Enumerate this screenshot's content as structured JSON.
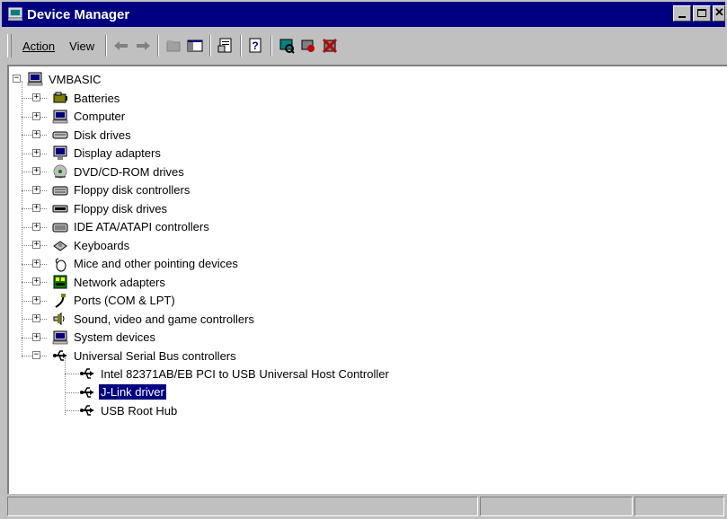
{
  "window": {
    "title": "Device Manager"
  },
  "menu": {
    "action": "Action",
    "view": "View"
  },
  "toolbar_icons": [
    "back-arrow-icon",
    "forward-arrow-icon",
    "up-folder-icon",
    "show-hide-tree-icon",
    "properties-icon",
    "help-icon",
    "scan-hardware-icon",
    "update-driver-icon",
    "uninstall-icon"
  ],
  "tree": {
    "root": "VMBASIC",
    "categories": [
      "Batteries",
      "Computer",
      "Disk drives",
      "Display adapters",
      "DVD/CD-ROM drives",
      "Floppy disk controllers",
      "Floppy disk drives",
      "IDE ATA/ATAPI controllers",
      "Keyboards",
      "Mice and other pointing devices",
      "Network adapters",
      "Ports (COM & LPT)",
      "Sound, video and game controllers",
      "System devices",
      "Universal Serial Bus controllers"
    ],
    "usb_children": [
      "Intel 82371AB/EB PCI to USB Universal Host Controller",
      "J-Link driver",
      "USB Root Hub"
    ],
    "selected": "J-Link driver"
  },
  "colors": {
    "titlebar": "#000080",
    "selection": "#000080",
    "face": "#c0c0c0"
  }
}
